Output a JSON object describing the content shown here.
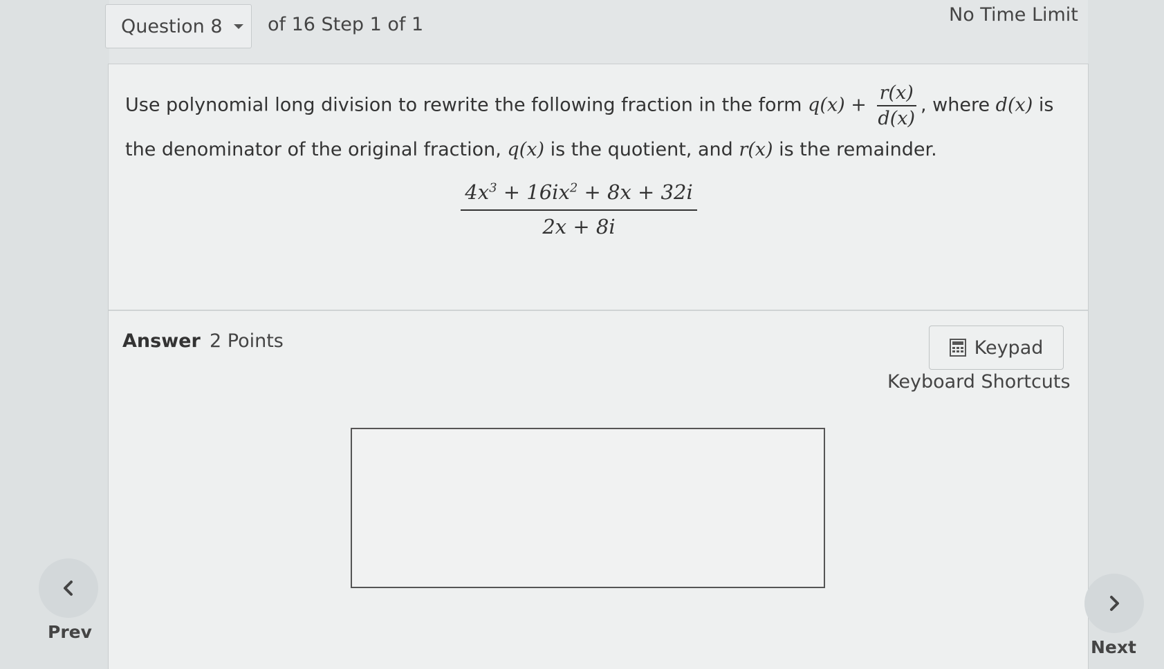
{
  "header": {
    "question_label": "Question 8",
    "step_info": "of 16 Step 1 of 1",
    "time_limit": "No Time Limit"
  },
  "question": {
    "intro": "Use polynomial long division to rewrite the following fraction in the form ",
    "form_q": "q(x)",
    "form_plus": " + ",
    "form_r": "r(x)",
    "form_d": "d(x)",
    "after_form": ", where ",
    "d_sym": "d(x)",
    "after_d": " is the denominator of the original fraction, ",
    "q_sym": "q(x)",
    "after_q": " is the quotient, and ",
    "r_sym": "r(x)",
    "after_r": " is the remainder."
  },
  "expression": {
    "num_a": "4x",
    "num_a_exp": "3",
    "num_b": " + 16ix",
    "num_b_exp": "2",
    "num_c": " + 8x + 32i",
    "denominator": "2x + 8i"
  },
  "answer": {
    "label": "Answer",
    "points": "2 Points",
    "input_value": ""
  },
  "tools": {
    "keypad_label": "Keypad",
    "shortcuts_label": "Keyboard Shortcuts"
  },
  "nav": {
    "prev_label": "Prev",
    "next_label": "Next"
  },
  "icons": {
    "question_dropdown": "caret-down-icon",
    "keypad": "calculator-icon",
    "prev": "chevron-left-icon",
    "next": "chevron-right-icon"
  }
}
